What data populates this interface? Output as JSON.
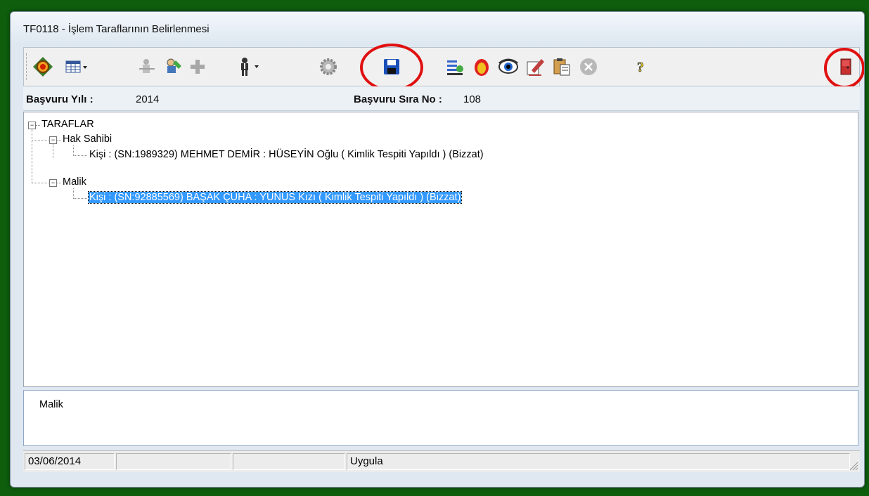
{
  "window": {
    "title": "TF0118 - İşlem Taraflarının Belirlenmesi"
  },
  "toolbar": {
    "icons": [
      "frame-icon",
      "grid-menu-icon",
      "disabled-person-icon",
      "edit-person-icon",
      "add-icon",
      "person-menu-icon",
      "gear-icon",
      "save-icon",
      "transfer-icon",
      "fire-icon",
      "eye-icon",
      "edit-doc-icon",
      "clipboard-icon",
      "cancel-icon",
      "help-icon",
      "exit-door-icon"
    ]
  },
  "info": {
    "year_label": "Başvuru Yılı :",
    "year_value": "2014",
    "seq_label": "Başvuru Sıra No :",
    "seq_value": "108"
  },
  "tree": {
    "root": "TARAFLAR",
    "groups": [
      {
        "label": "Hak Sahibi",
        "children": [
          "Kişi : (SN:1989329) MEHMET DEMİR : HÜSEYİN Oğlu  ( Kimlik Tespiti Yapıldı ) (Bizzat)"
        ]
      },
      {
        "label": "Malik",
        "children": [
          "Kişi : (SN:92885569) BAŞAK ÇUHA : YUNUS Kızı  ( Kimlik Tespiti Yapıldı ) (Bizzat)"
        ]
      }
    ]
  },
  "description": {
    "text": "Malik"
  },
  "status": {
    "date": "03/06/2014",
    "cell2": "",
    "cell3": "",
    "action": "Uygula"
  },
  "colors": {
    "selection": "#3399ff",
    "highlight_circle": "#e01010",
    "frame": "#0e5e0e"
  }
}
